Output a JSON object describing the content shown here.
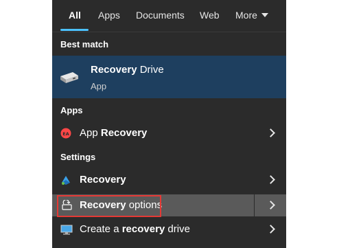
{
  "tabs": [
    {
      "label": "All"
    },
    {
      "label": "Apps"
    },
    {
      "label": "Documents"
    },
    {
      "label": "Web"
    },
    {
      "label": "More"
    }
  ],
  "best_match": {
    "section_label": "Best match",
    "title_bold": "Recovery",
    "title_rest": " Drive",
    "subtitle": "App",
    "icon": "drive-icon"
  },
  "apps": {
    "section_label": "Apps",
    "items": [
      {
        "pre": "App ",
        "bold": "Recovery",
        "post": "",
        "icon": "ea-app-icon"
      }
    ]
  },
  "settings": {
    "section_label": "Settings",
    "items": [
      {
        "pre": "",
        "bold": "Recovery",
        "post": "",
        "icon": "windows-update-icon"
      },
      {
        "pre": "",
        "bold": "Recovery",
        "post": " options",
        "icon": "recovery-options-icon"
      },
      {
        "pre": "Create a ",
        "bold": "recovery",
        "post": " drive",
        "icon": "monitor-icon"
      }
    ]
  },
  "colors": {
    "panel": "#2b2b2b",
    "accent": "#4cc2ff",
    "best_match_bg": "#1e3f5f",
    "highlight_box": "#e53935"
  }
}
